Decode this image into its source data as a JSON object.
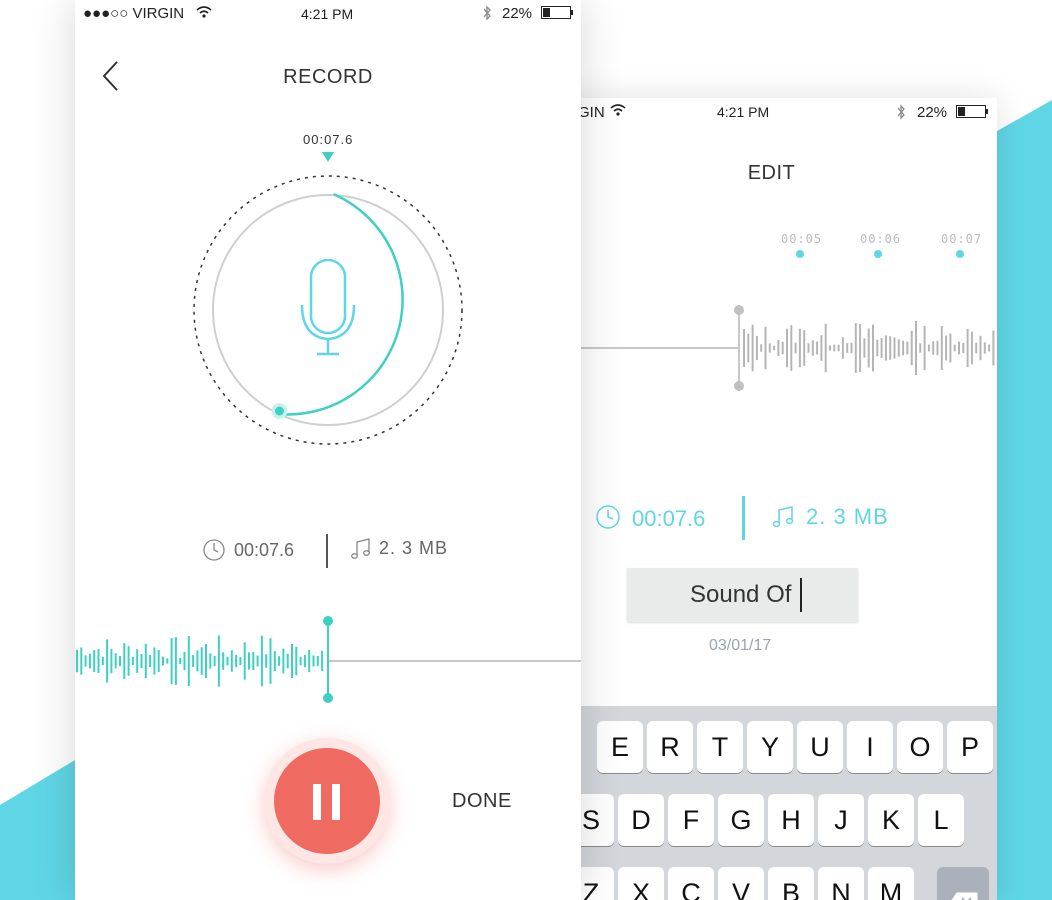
{
  "colors": {
    "accent_teal": "#3ed1c3",
    "accent_cyan": "#5fd6e6",
    "record_red": "#ef6b61",
    "bg_cyan": "#5fd6e6"
  },
  "record_screen": {
    "status": {
      "carrier": "●●●○○ VIRGIN",
      "time": "4:21 PM",
      "battery": "22%"
    },
    "title": "RECORD",
    "timer_label": "00:07.6",
    "info": {
      "duration": "00:07.6",
      "size": "2. 3 MB"
    },
    "done_label": "DONE",
    "icons": [
      "back-chevron-icon",
      "wifi-icon",
      "bluetooth-icon",
      "battery-icon",
      "microphone-icon",
      "clock-icon",
      "music-note-icon",
      "pause-icon"
    ]
  },
  "edit_screen": {
    "status": {
      "carrier": "GIN",
      "time": "4:21 PM",
      "battery": "22%"
    },
    "title": "EDIT",
    "timeline": [
      "00:05",
      "00:06",
      "00:07"
    ],
    "info": {
      "duration": "00:07.6",
      "size": "2. 3 MB"
    },
    "name_value": "Sound Of",
    "date": "03/01/17",
    "keyboard": {
      "row1": [
        "E",
        "R",
        "T",
        "Y",
        "U",
        "I",
        "O",
        "P"
      ],
      "row2": [
        "S",
        "D",
        "F",
        "G",
        "H",
        "J",
        "K",
        "L"
      ],
      "row3": [
        "Z",
        "X",
        "C",
        "V",
        "B",
        "N",
        "M"
      ]
    }
  }
}
